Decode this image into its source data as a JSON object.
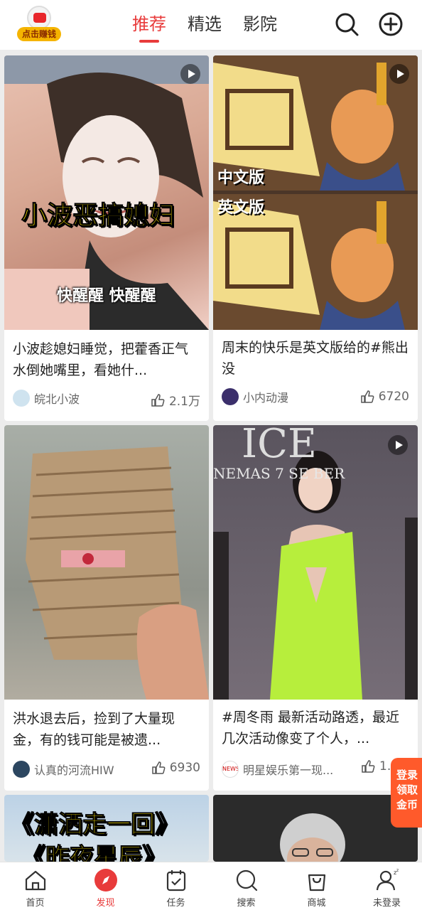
{
  "header": {
    "reward_label": "点击赚钱",
    "tabs": [
      "推荐",
      "精选",
      "影院"
    ],
    "active_tab": 0
  },
  "feed": [
    {
      "overlay_title": "小波恶搞媳妇",
      "overlay_sub": "快醒醒 快醒醒",
      "caption": "小波趁媳妇睡觉，把藿香正气水倒她嘴里，看她什...",
      "author": "皖北小波",
      "likes": "2.1万"
    },
    {
      "overlay_top": "中文版",
      "overlay_bottom": "英文版",
      "caption": "周末的快乐是英文版给的#熊出没",
      "author": "小内动漫",
      "likes": "6720"
    },
    {
      "caption": "洪水退去后，捡到了大量现金，有的钱可能是被遗...",
      "author": "认真的河流HIW",
      "likes": "6930"
    },
    {
      "backdrop_big": "ICE",
      "backdrop_line": "NEMAS 7 SE BER",
      "caption": "#周冬雨 最新活动路透，最近几次活动像变了个人，...",
      "author": "明星娱乐第一现...",
      "likes": "1.",
      "avatar_text": "NEWS"
    },
    {
      "overlay_line1": "《潇洒走一回》",
      "overlay_line2": "《昨夜星辰》"
    },
    {}
  ],
  "float_login": [
    "登录",
    "领取",
    "金币"
  ],
  "bottom_nav": [
    {
      "label": "首页",
      "icon": "home-icon"
    },
    {
      "label": "发现",
      "icon": "compass-icon"
    },
    {
      "label": "任务",
      "icon": "task-icon"
    },
    {
      "label": "搜索",
      "icon": "search-icon"
    },
    {
      "label": "商城",
      "icon": "shopping-bag-icon"
    },
    {
      "label": "未登录",
      "icon": "user-icon"
    }
  ],
  "colors": {
    "accent": "#e83b3b",
    "overlay_yellow": "#ffe600",
    "login_orange": "#ff5a2b",
    "dress_green": "#b7ee3c"
  }
}
